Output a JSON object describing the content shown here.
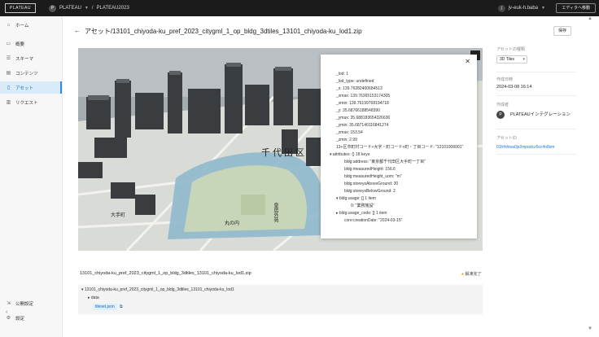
{
  "topbar": {
    "logo": "PLATEAU",
    "workspace_initial": "P",
    "workspace_name": "PLATEAU",
    "separator": "/",
    "project_name": "PLATEAU2023",
    "user_initial": "j",
    "user_name": "jv-euk-h.baba",
    "editor_button": "エディタへ移動"
  },
  "sidebar": {
    "items": [
      {
        "label": "ホーム",
        "icon": "home-icon"
      },
      {
        "label": "概要",
        "icon": "overview-icon"
      },
      {
        "label": "スキーマ",
        "icon": "schema-icon"
      },
      {
        "label": "コンテンツ",
        "icon": "content-icon"
      },
      {
        "label": "アセット",
        "icon": "asset-icon",
        "active": true
      },
      {
        "label": "リクエスト",
        "icon": "request-icon"
      }
    ],
    "bottom_items": [
      {
        "label": "公開設定",
        "icon": "publish-icon"
      },
      {
        "label": "設定",
        "icon": "settings-icon"
      }
    ],
    "collapse_icon": "‹"
  },
  "header": {
    "title": "アセット/13101_chiyoda-ku_pref_2023_citygml_1_op_bldg_3dtiles_13101_chiyoda-ku_lod1.zip",
    "save_label": "保存"
  },
  "popup": {
    "rows": [
      {
        "text": "_lod:  1",
        "indent": 0
      },
      {
        "text": "_lod_type:  undefined",
        "indent": 0
      },
      {
        "text": "_x:  139.76282400684513",
        "indent": 0
      },
      {
        "text": "_xmax:  139.76365153174305",
        "indent": 0
      },
      {
        "text": "_xmin:  139.76199768194718",
        "indent": 0
      },
      {
        "text": "_y:  35.68766188548390",
        "indent": 0
      },
      {
        "text": "_ymax:  35.688183654326636",
        "indent": 0
      },
      {
        "text": "_ymin:  35.687140116841274",
        "indent": 0
      },
      {
        "text": "_zmax:  153.54",
        "indent": 0
      },
      {
        "text": "_zmin:  2.99",
        "indent": 0
      },
      {
        "text": "13+区市町村コード+大字・町コード+町・丁目コード:  \"13101006001\"",
        "indent": 0
      },
      {
        "text": "▾ attributes:  {}  18 keys",
        "indent": -1
      },
      {
        "text": "bldg:address:  \"東京都千代田区大手町一丁目\"",
        "indent": 1
      },
      {
        "text": "bldg:measuredHeight:  156.6",
        "indent": 1
      },
      {
        "text": "bldg:measuredHeight_uom:  \"m\"",
        "indent": 1
      },
      {
        "text": "bldg:storeysAboveGround:  30",
        "indent": 1
      },
      {
        "text": "bldg:storeysBelowGround:  2",
        "indent": 1
      },
      {
        "text": "▾ bldg:usage:  []  1 item",
        "indent": 0
      },
      {
        "text": "0:  \"業務施設\"",
        "indent": 2
      },
      {
        "text": "▸ bldg:usage_code:  []  1 item",
        "indent": 0
      },
      {
        "text": "core:creationDate:  \"2024-03-15\"",
        "indent": 1
      }
    ]
  },
  "file": {
    "name": "13101_chiyoda-ku_pref_2023_citygml_1_op_bldg_3dtiles_13101_chiyoda-ku_lod1.zip",
    "status": "解凍完了",
    "tree": {
      "root": "13101_chiyoda-ku_pref_2023_citygml_1_op_bldg_3dtiles_13101_chiyoda-ku_lod1",
      "folder": "data",
      "file": "tileset.json"
    }
  },
  "right_panel": {
    "asset_type_label": "アセットの種類",
    "asset_type_value": "3D Tiles",
    "created_at_label": "作成日時",
    "created_at_value": "2024-03-08 16:14",
    "creator_label": "作成者",
    "creator_initial": "P",
    "creator_name": "PLATEAUインテグレーション",
    "id_label": "アセットID",
    "id_value": "01hfnhtsa0js2mpodcz5cc4n8sm"
  },
  "map_labels": [
    "千代田区",
    "皇居外苑",
    "大手町",
    "丸の内"
  ]
}
